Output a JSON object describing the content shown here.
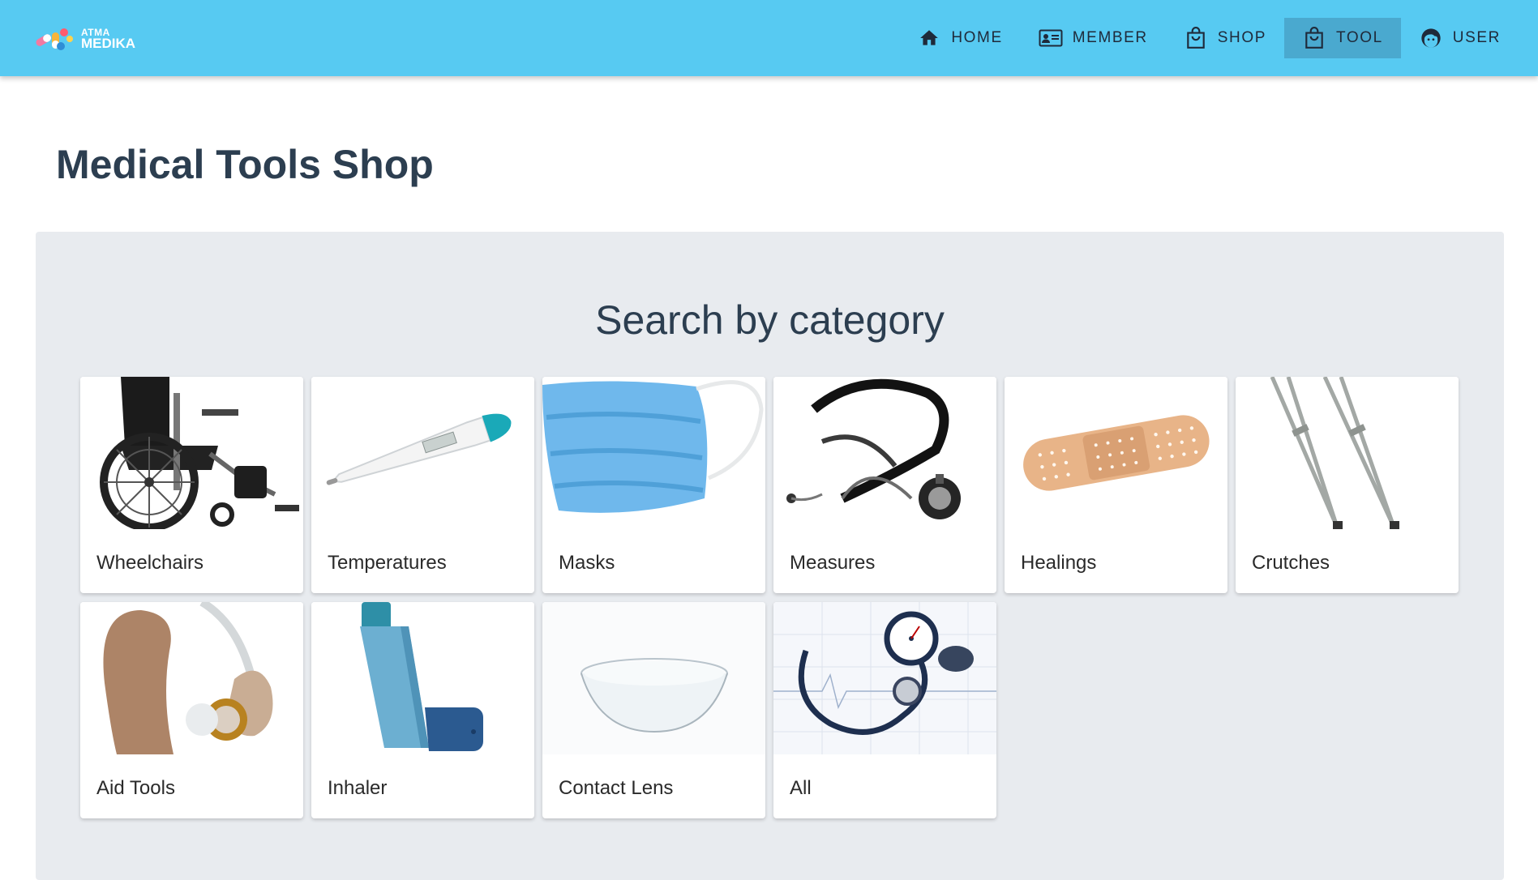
{
  "app": {
    "logo_line1": "ATMA",
    "logo_line2": "MEDIKA"
  },
  "nav": {
    "items": [
      {
        "label": "HOME",
        "icon": "home-icon"
      },
      {
        "label": "MEMBER",
        "icon": "id-card-icon"
      },
      {
        "label": "SHOP",
        "icon": "shopping-bag-icon"
      },
      {
        "label": "TOOL",
        "icon": "shopping-bag-icon",
        "active": true
      },
      {
        "label": "USER",
        "icon": "face-icon"
      }
    ]
  },
  "page": {
    "title": "Medical Tools Shop"
  },
  "categories": {
    "heading": "Search by category",
    "items": [
      {
        "label": "Wheelchairs",
        "image": "wheelchair"
      },
      {
        "label": "Temperatures",
        "image": "thermometer"
      },
      {
        "label": "Masks",
        "image": "face-mask"
      },
      {
        "label": "Measures",
        "image": "stethoscope"
      },
      {
        "label": "Healings",
        "image": "bandage"
      },
      {
        "label": "Crutches",
        "image": "crutches"
      },
      {
        "label": "Aid Tools",
        "image": "hearing-aid"
      },
      {
        "label": "Inhaler",
        "image": "inhaler"
      },
      {
        "label": "Contact Lens",
        "image": "contact-lens"
      },
      {
        "label": "All",
        "image": "stethoscope-and-blood-pressure-gauge"
      }
    ]
  },
  "colors": {
    "topbar": "#57caf2",
    "active_nav": "#4aa9cf",
    "title": "#2c3e50",
    "panel": "#e8ebef"
  }
}
